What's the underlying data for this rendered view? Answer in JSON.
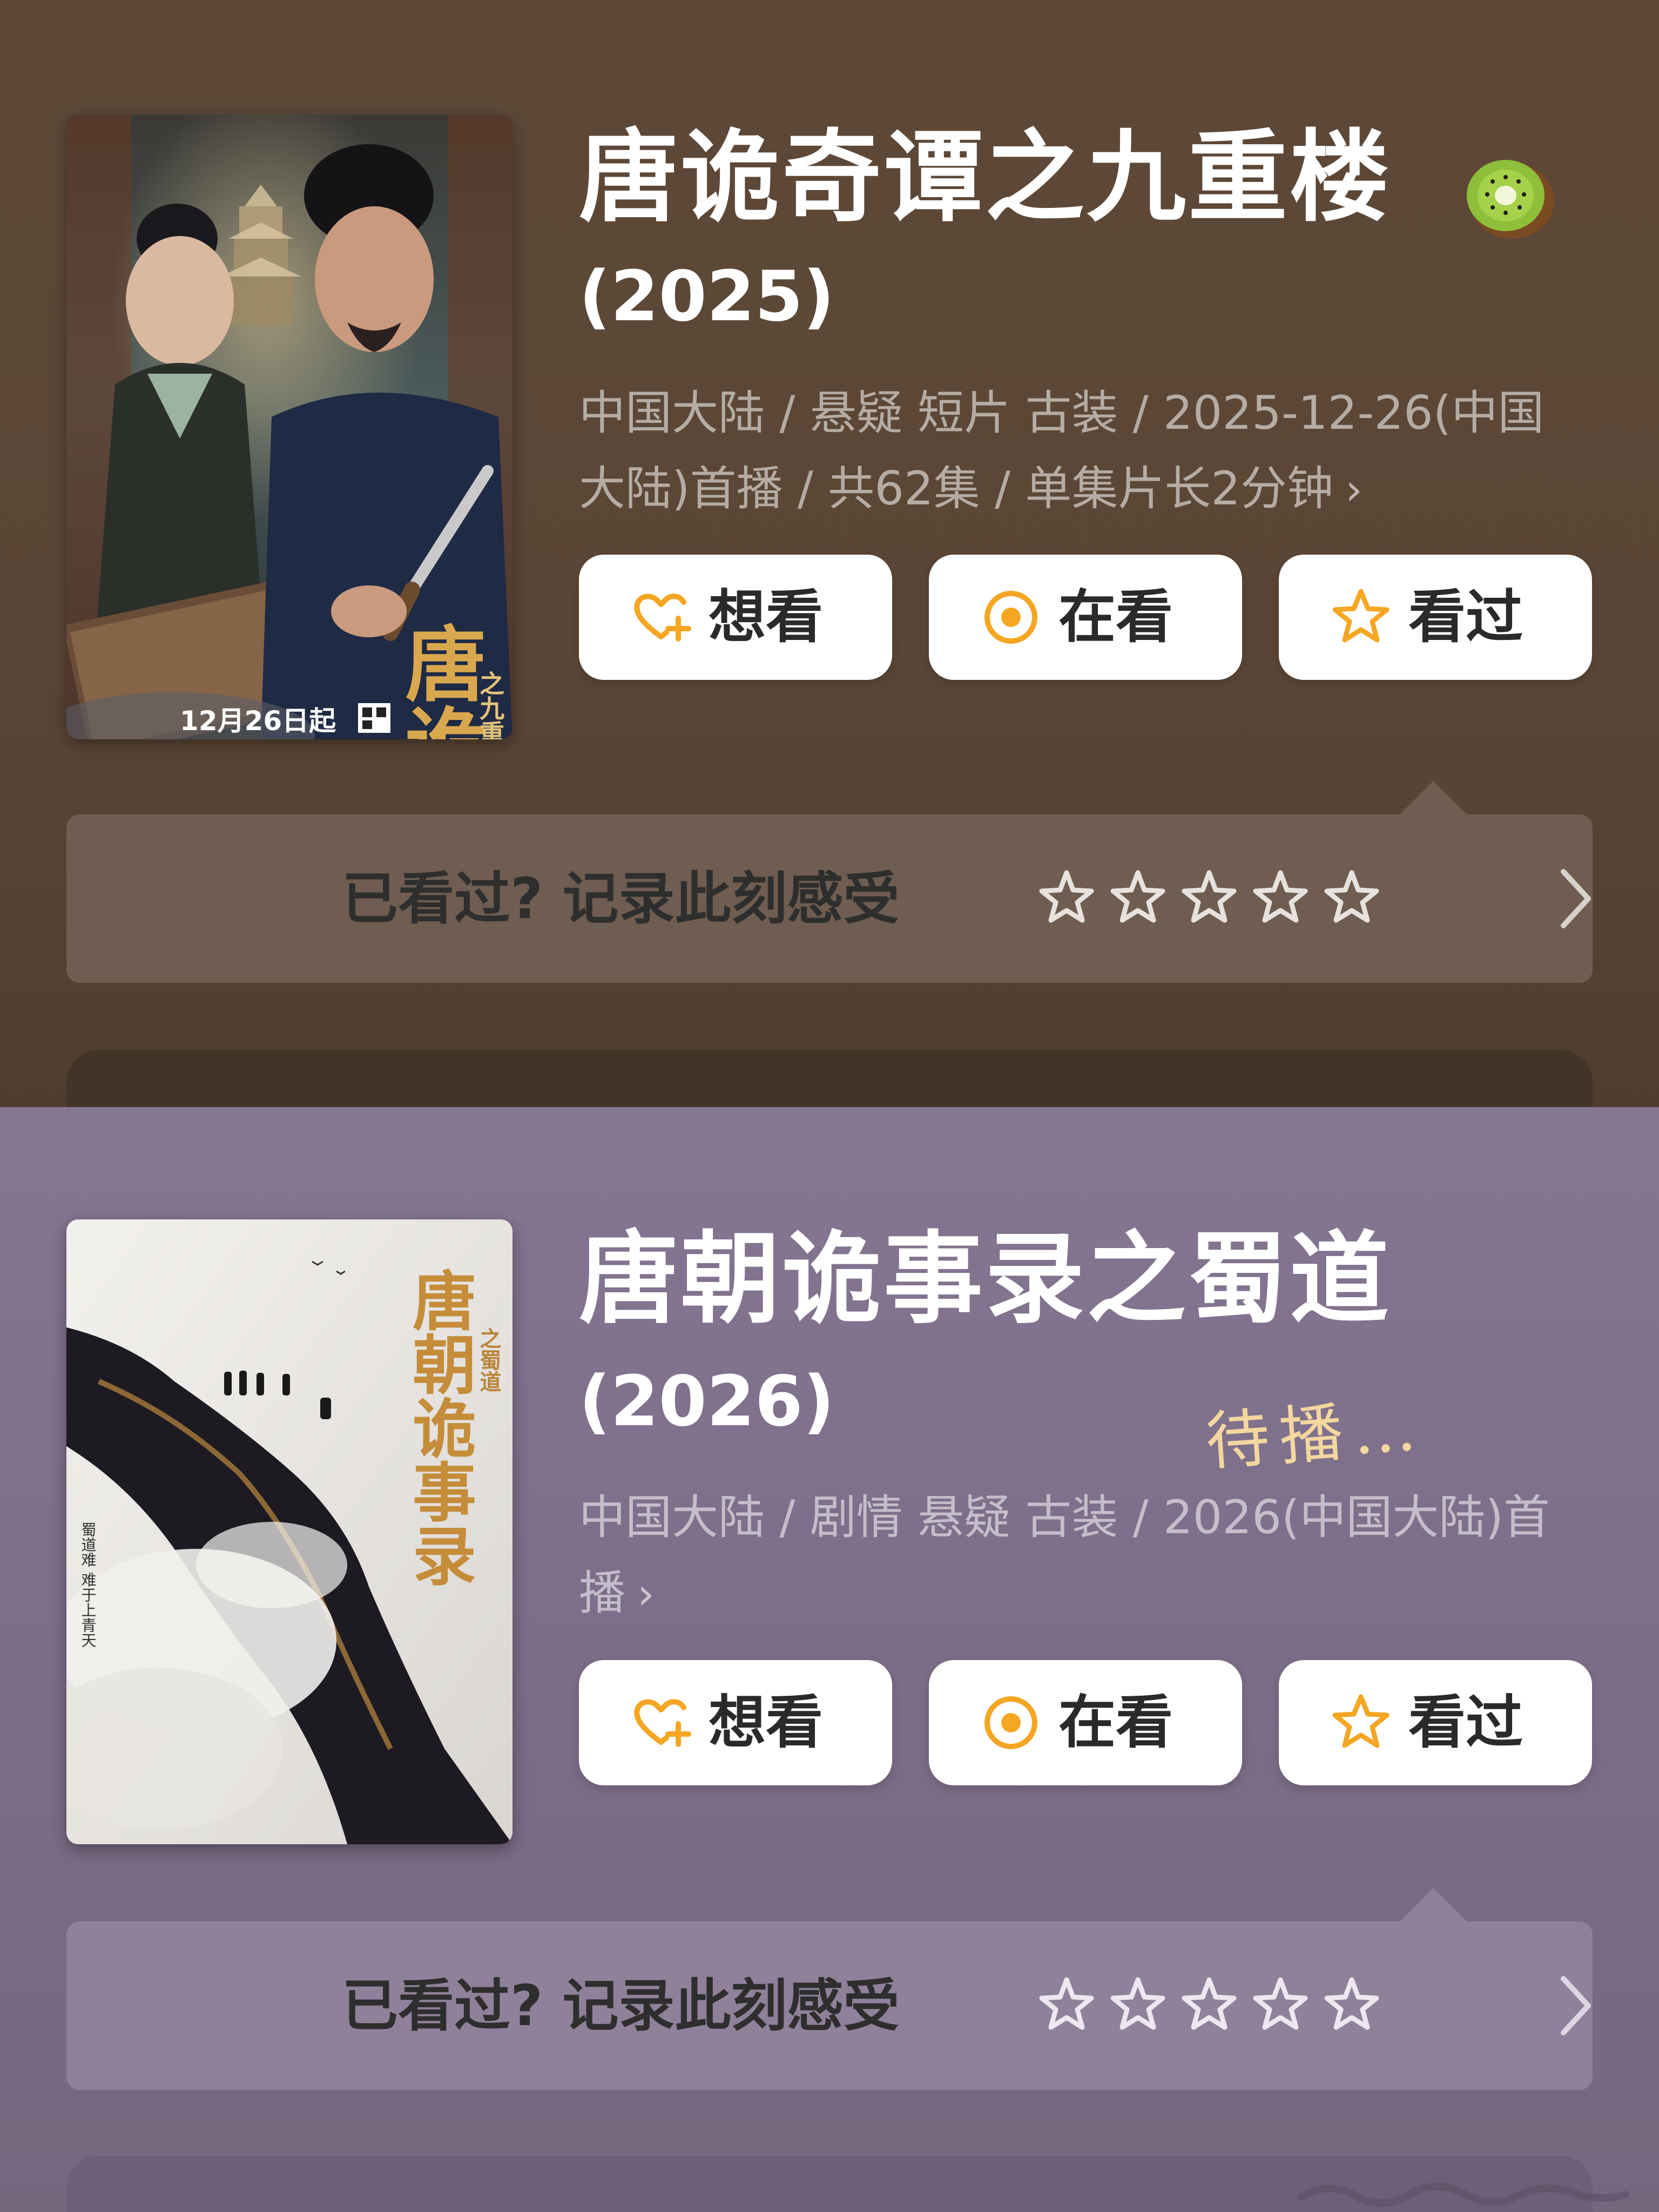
{
  "entries": [
    {
      "title": "唐诡奇谭之九重楼",
      "year": "(2025)",
      "meta": "中国大陆 / 悬疑 短片 古装 / 2025-12-26(中国大陆)首播 / 共62集 / 单集片长2分钟",
      "meta_chevron": "›",
      "badge_icon": "kiwi-icon",
      "poster_text": {
        "title": "唐诡奇谭",
        "subtitle": "之九重楼",
        "date": "12月26日起"
      },
      "actions": {
        "want": "想看",
        "watching": "在看",
        "watched": "看过"
      },
      "rating": {
        "prompt": "已看过? 记录此刻感受",
        "stars": 0,
        "max_stars": 5
      }
    },
    {
      "title": "唐朝诡事录之蜀道",
      "year": "(2026)",
      "meta": "中国大陆 / 剧情 悬疑 古装 / 2026(中国大陆)首播",
      "meta_chevron": "›",
      "annotation": "待播…",
      "poster_text": {
        "title": "唐朝诡事录",
        "subtitle": "之蜀道",
        "tagline": "蜀道难 难于上青天"
      },
      "actions": {
        "want": "想看",
        "watching": "在看",
        "watched": "看过"
      },
      "rating": {
        "prompt": "已看过? 记录此刻感受",
        "stars": 0,
        "max_stars": 5
      }
    }
  ],
  "colors": {
    "panel1_bg": "#5e4938",
    "panel2_bg": "#7c6d88",
    "accent_orange": "#f5a623",
    "button_bg": "#ffffff",
    "handwritten": "#f3d79f"
  }
}
